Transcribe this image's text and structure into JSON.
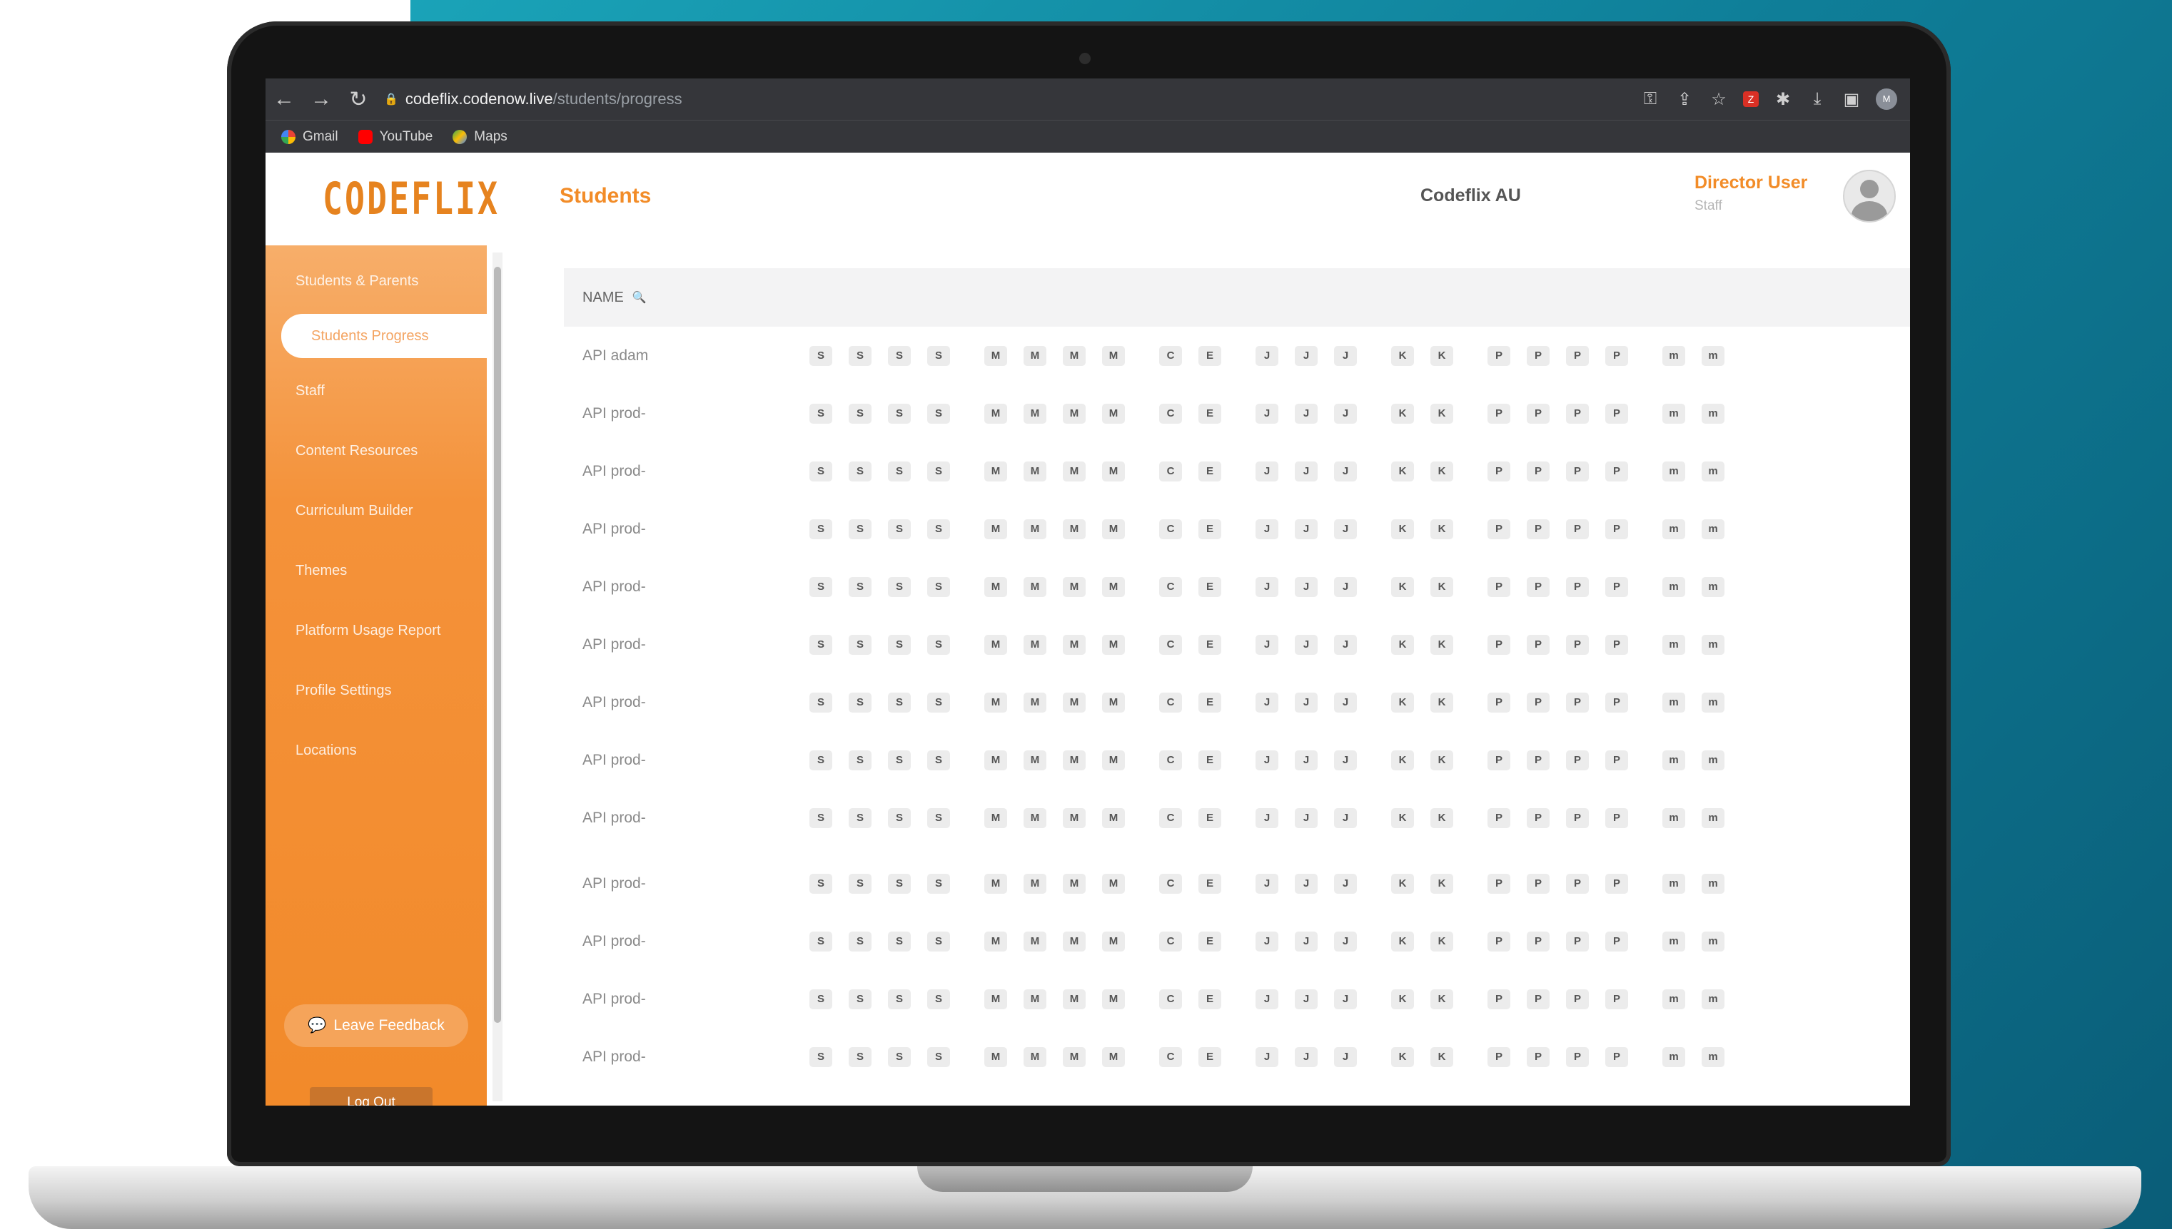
{
  "browser": {
    "url_host": "codeflix.codenow.live",
    "url_path": "/students/progress",
    "profile_initials": "M",
    "extension_badge": "Z",
    "bookmarks": [
      {
        "label": "Gmail",
        "color": "#ea4335"
      },
      {
        "label": "YouTube",
        "color": "#ff0000"
      },
      {
        "label": "Maps",
        "color": "#34a853"
      }
    ]
  },
  "app": {
    "logo": "CODEFLIX",
    "page_title": "Students",
    "org_name": "Codeflix AU",
    "user_name": "Director User",
    "user_role": "Staff",
    "accent_color": "#f28c28"
  },
  "sidebar": {
    "items": [
      {
        "label": "Students & Parents",
        "active": false
      },
      {
        "label": "Students Progress",
        "active": true
      },
      {
        "label": "Staff",
        "active": false
      },
      {
        "label": "Content Resources",
        "active": false
      },
      {
        "label": "Curriculum Builder",
        "active": false
      },
      {
        "label": "Themes",
        "active": false
      },
      {
        "label": "Platform Usage Report",
        "active": false
      },
      {
        "label": "Profile Settings",
        "active": false
      },
      {
        "label": "Locations",
        "active": false
      }
    ],
    "feedback_label": "Leave Feedback",
    "logout_label": "Log Out"
  },
  "table": {
    "name_header": "NAME",
    "groups": [
      {
        "key": "s",
        "chips": [
          "S",
          "S",
          "S",
          "S"
        ]
      },
      {
        "key": "m",
        "chips": [
          "M",
          "M",
          "M",
          "M"
        ]
      },
      {
        "key": "c",
        "chips": [
          "C",
          "E"
        ]
      },
      {
        "key": "j",
        "chips": [
          "J",
          "J",
          "J"
        ]
      },
      {
        "key": "k",
        "chips": [
          "K",
          "K"
        ]
      },
      {
        "key": "p",
        "chips": [
          "P",
          "P",
          "P",
          "P"
        ]
      },
      {
        "key": "mm",
        "chips": [
          "m",
          "m"
        ]
      }
    ],
    "rows": [
      "API adam",
      "API prod-",
      "API prod-",
      "API prod-",
      "API prod-",
      "API prod-",
      "API prod-",
      "API prod-",
      "API prod-",
      "API prod-",
      "API prod-",
      "API prod-",
      "API prod-"
    ]
  }
}
